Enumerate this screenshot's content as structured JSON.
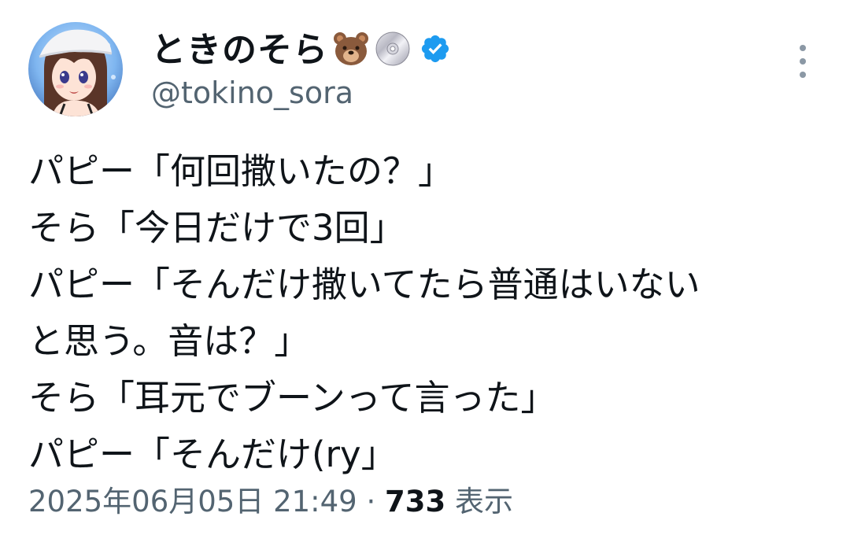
{
  "author": {
    "display_name": "ときのそら",
    "handle": "@tokino_sora",
    "emoji": [
      "bear-emoji",
      "disc-emoji"
    ],
    "verified": true
  },
  "tweet": {
    "lines": [
      "パピー「何回撒いたの？」",
      "そら「今日だけで3回」",
      "パピー「そんだけ撒いてたら普通はいない",
      "と思う。音は？」",
      "そら「耳元でブーンって言った」",
      "パピー「そんだけ(ry」"
    ]
  },
  "meta": {
    "timestamp": "2025年06月05日 21:49",
    "separator": "·",
    "views_count": "733",
    "views_label": "表示"
  },
  "colors": {
    "text": "#0f1419",
    "secondary": "#536471",
    "verified": "#1d9bf0"
  }
}
